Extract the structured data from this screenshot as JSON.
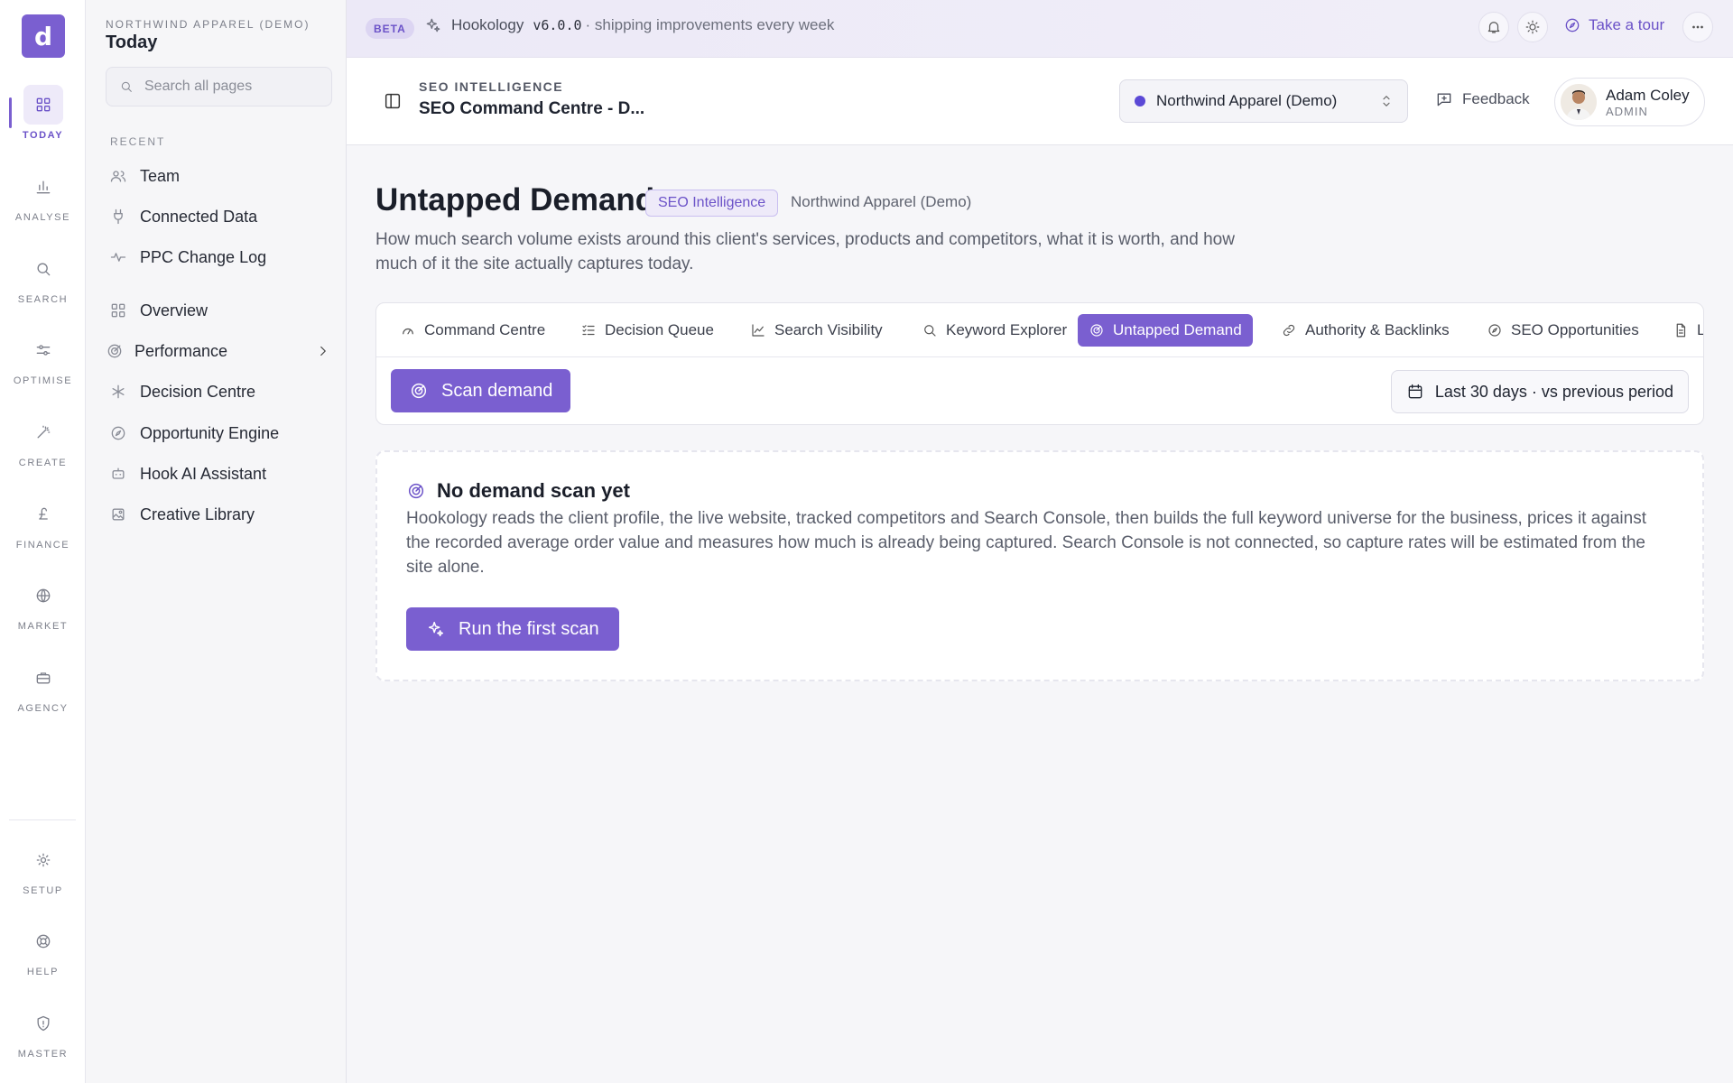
{
  "rail": {
    "logo": "d",
    "items": [
      {
        "label": "Today",
        "icon": "grid-icon"
      },
      {
        "label": "Analyse",
        "icon": "bar-chart-icon"
      },
      {
        "label": "Search",
        "icon": "search-icon"
      },
      {
        "label": "Optimise",
        "icon": "sliders-icon"
      },
      {
        "label": "Create",
        "icon": "magic-wand-icon"
      },
      {
        "label": "Finance",
        "icon": "pound-icon"
      },
      {
        "label": "Market",
        "icon": "globe-icon"
      },
      {
        "label": "Agency",
        "icon": "briefcase-icon"
      }
    ],
    "bottom": [
      {
        "label": "Setup",
        "icon": "gear-icon"
      },
      {
        "label": "Help",
        "icon": "lifebuoy-icon"
      },
      {
        "label": "Master",
        "icon": "shield-icon"
      }
    ]
  },
  "side": {
    "workspace": "Northwind Apparel (Demo)",
    "title": "Today",
    "search_placeholder": "Search all pages",
    "recent_label": "Recent",
    "recent": [
      "Team",
      "Connected Data",
      "PPC Change Log"
    ],
    "nav": [
      "Overview",
      "Performance",
      "Decision Centre",
      "Opportunity Engine",
      "Hook AI Assistant",
      "Creative Library"
    ]
  },
  "topbar": {
    "badge": "BETA",
    "product": "Hookology",
    "version": "v6.0.0",
    "tagline": "· shipping improvements every week",
    "tour": "Take a tour"
  },
  "header": {
    "section": "SEO Intelligence",
    "title": "SEO Command Centre - D...",
    "client": "Northwind Apparel (Demo)",
    "feedback": "Feedback",
    "user_name": "Adam Coley",
    "user_role": "ADMIN"
  },
  "page": {
    "title": "Untapped Demand",
    "tag": "SEO Intelligence",
    "client": "Northwind Apparel (Demo)",
    "description": "How much search volume exists around this client's services, products and competitors, what it is worth, and how much of it the site actually captures today."
  },
  "tabs": [
    {
      "label": "Command Centre",
      "icon": "gauge-icon"
    },
    {
      "label": "Decision Queue",
      "icon": "checklist-icon"
    },
    {
      "label": "Search Visibility",
      "icon": "line-chart-icon"
    },
    {
      "label": "Keyword Explorer",
      "icon": "search-icon"
    },
    {
      "label": "Untapped Demand",
      "icon": "radar-icon",
      "active": true
    },
    {
      "label": "Authority & Backlinks",
      "icon": "link-icon"
    },
    {
      "label": "SEO Opportunities",
      "icon": "compass-icon"
    },
    {
      "label": "L",
      "icon": "document-icon"
    }
  ],
  "toolbar": {
    "scan_button": "Scan demand",
    "date_range": "Last 30 days · vs previous period"
  },
  "empty": {
    "title": "No demand scan yet",
    "description": "Hookology reads the client profile, the live website, tracked competitors and Search Console, then builds the full keyword universe for the business, prices it against the recorded average order value and measures how much is already being captured. Search Console is not connected, so capture rates will be estimated from the site alone.",
    "button": "Run the first scan"
  },
  "colors": {
    "accent": "#7a5fd0",
    "accent_soft": "#eeeaf9",
    "client_dot": "#5b49d6"
  }
}
